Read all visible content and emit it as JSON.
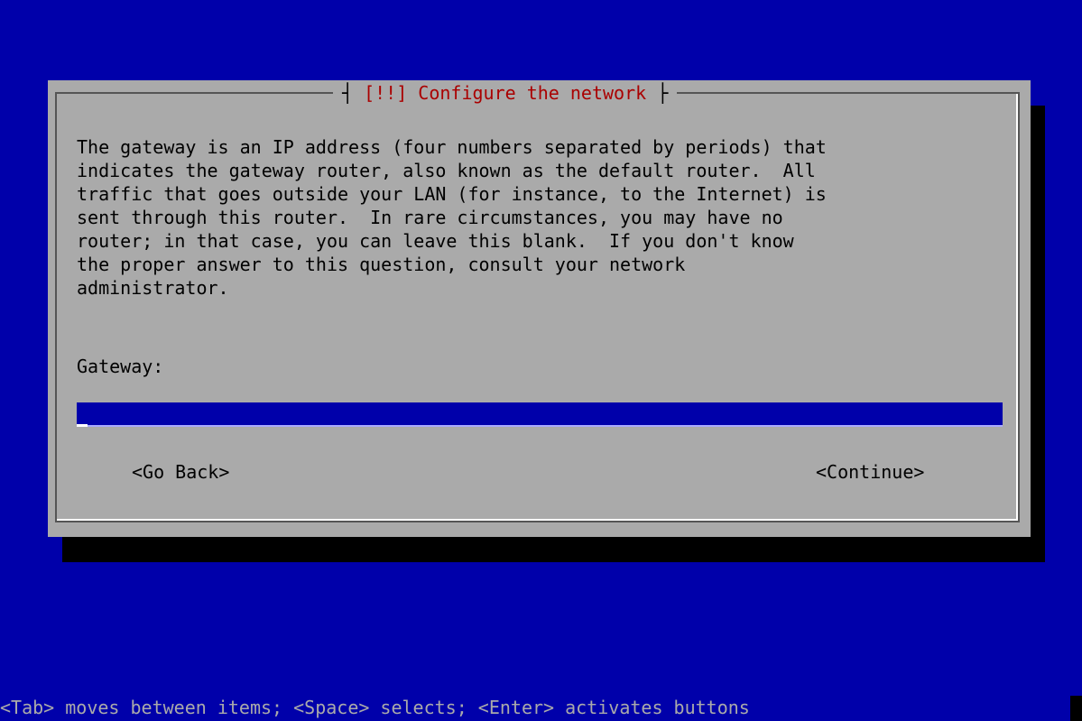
{
  "dialog": {
    "title": "[!!] Configure the network",
    "message": "The gateway is an IP address (four numbers separated by periods) that\nindicates the gateway router, also known as the default router.  All\ntraffic that goes outside your LAN (for instance, to the Internet) is\nsent through this router.  In rare circumstances, you may have no\nrouter; in that case, you can leave this blank.  If you don't know\nthe proper answer to this question, consult your network\nadministrator.",
    "field_label": "Gateway:",
    "field_value": "",
    "back_button": "<Go Back>",
    "continue_button": "<Continue>"
  },
  "help_line": "<Tab> moves between items; <Space> selects; <Enter> activates buttons",
  "colors": {
    "background": "#0000aa",
    "dialog": "#aaaaaa",
    "title": "#aa0000",
    "input": "#0000aa",
    "shadow": "#000000"
  }
}
